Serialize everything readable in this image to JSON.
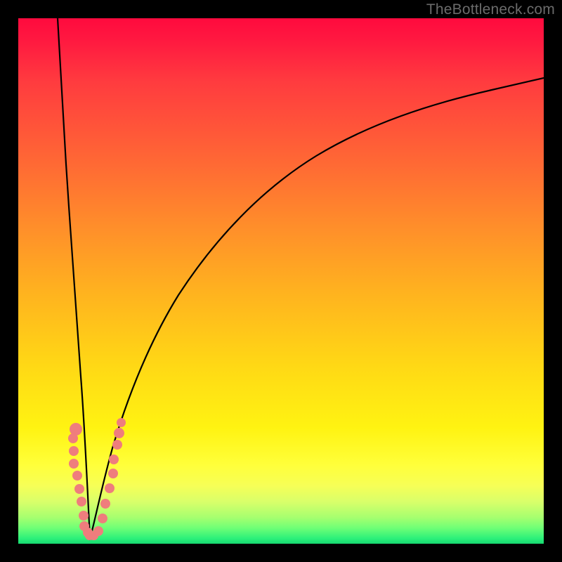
{
  "watermark": "TheBottleneck.com",
  "gradient_colors": {
    "top": "#ff0a3e",
    "mid_red": "#ff3b3f",
    "orange": "#ff8f2a",
    "yellow": "#ffd815",
    "light_yellow": "#ffff3a",
    "green_light": "#a6ff6f",
    "green_bottom": "#16d770"
  },
  "dot_style": {
    "color": "#ef7d7d",
    "size_min": 12,
    "size_max": 20
  },
  "dots": [
    {
      "x_pct": 11.0,
      "y_pct": 78.2,
      "size": 18
    },
    {
      "x_pct": 10.4,
      "y_pct": 80.0,
      "size": 14
    },
    {
      "x_pct": 10.6,
      "y_pct": 82.3,
      "size": 14
    },
    {
      "x_pct": 10.6,
      "y_pct": 84.8,
      "size": 14
    },
    {
      "x_pct": 11.2,
      "y_pct": 87.0,
      "size": 14
    },
    {
      "x_pct": 11.6,
      "y_pct": 89.6,
      "size": 14
    },
    {
      "x_pct": 12.0,
      "y_pct": 92.0,
      "size": 14
    },
    {
      "x_pct": 12.4,
      "y_pct": 94.6,
      "size": 14
    },
    {
      "x_pct": 12.6,
      "y_pct": 96.6,
      "size": 14
    },
    {
      "x_pct": 13.2,
      "y_pct": 97.8,
      "size": 14
    },
    {
      "x_pct": 13.6,
      "y_pct": 98.4,
      "size": 13
    },
    {
      "x_pct": 14.4,
      "y_pct": 98.4,
      "size": 13
    },
    {
      "x_pct": 15.2,
      "y_pct": 97.6,
      "size": 14
    },
    {
      "x_pct": 16.0,
      "y_pct": 95.2,
      "size": 14
    },
    {
      "x_pct": 16.6,
      "y_pct": 92.4,
      "size": 14
    },
    {
      "x_pct": 17.4,
      "y_pct": 89.4,
      "size": 14
    },
    {
      "x_pct": 18.0,
      "y_pct": 86.6,
      "size": 14
    },
    {
      "x_pct": 18.2,
      "y_pct": 84.0,
      "size": 14
    },
    {
      "x_pct": 18.8,
      "y_pct": 81.2,
      "size": 14
    },
    {
      "x_pct": 19.2,
      "y_pct": 79.0,
      "size": 15
    },
    {
      "x_pct": 19.6,
      "y_pct": 77.0,
      "size": 13
    }
  ],
  "chart_data": {
    "type": "line",
    "title": "",
    "xlabel": "",
    "ylabel": "",
    "xlim_pct": [
      0,
      100
    ],
    "ylim_pct": [
      0,
      100
    ],
    "series": [
      {
        "name": "left-branch",
        "x_pct": [
          7.5,
          8.3,
          9.1,
          9.9,
          10.7,
          11.5,
          12.0,
          12.6,
          13.0,
          13.6
        ],
        "y_pct": [
          0.0,
          18.0,
          38.0,
          56.0,
          72.0,
          84.0,
          91.6,
          96.4,
          98.2,
          99.2
        ]
      },
      {
        "name": "right-branch",
        "x_pct": [
          13.6,
          15.0,
          17.0,
          19.5,
          22.5,
          26.5,
          31.5,
          38.0,
          46.0,
          55.5,
          66.5,
          78.5,
          90.0,
          100.0
        ],
        "y_pct": [
          99.2,
          94.0,
          86.4,
          77.4,
          68.4,
          59.4,
          50.5,
          41.8,
          34.2,
          27.6,
          21.8,
          17.0,
          13.6,
          11.4
        ]
      }
    ],
    "scatter": {
      "name": "highlight-dots",
      "color": "#ef7d7d",
      "x_pct": [
        11.0,
        10.4,
        10.6,
        10.6,
        11.2,
        11.6,
        12.0,
        12.4,
        12.6,
        13.2,
        13.6,
        14.4,
        15.2,
        16.0,
        16.6,
        17.4,
        18.0,
        18.2,
        18.8,
        19.2,
        19.6
      ],
      "y_pct": [
        78.2,
        80.0,
        82.3,
        84.8,
        87.0,
        89.6,
        92.0,
        94.6,
        96.6,
        97.8,
        98.4,
        98.4,
        97.6,
        95.2,
        92.4,
        89.4,
        86.6,
        84.0,
        81.2,
        79.0,
        77.0
      ]
    },
    "notes": "x_pct / y_pct are percentages of the plotting rectangle; y_pct is measured from the top edge (0 = top, 100 = bottom). The two series together form a single continuous V-shaped black curve with its minimum near x≈13.6%, y≈99% (bottom)."
  }
}
